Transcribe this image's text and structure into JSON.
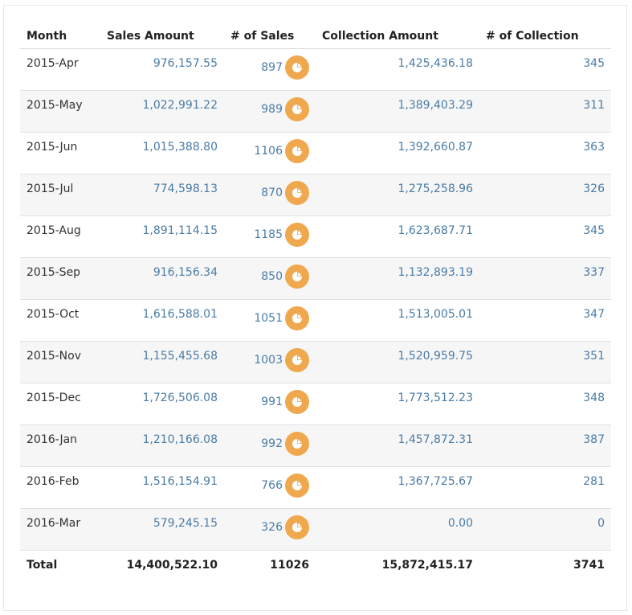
{
  "table": {
    "headers": {
      "month": "Month",
      "sales_amount": "Sales Amount",
      "num_sales": "# of Sales",
      "collection_amount": "Collection Amount",
      "num_collection": "# of Collection"
    },
    "rows": [
      {
        "month": "2015-Apr",
        "sales_amount": "976,157.55",
        "num_sales": "897",
        "collection_amount": "1,425,436.18",
        "num_collection": "345"
      },
      {
        "month": "2015-May",
        "sales_amount": "1,022,991.22",
        "num_sales": "989",
        "collection_amount": "1,389,403.29",
        "num_collection": "311"
      },
      {
        "month": "2015-Jun",
        "sales_amount": "1,015,388.80",
        "num_sales": "1106",
        "collection_amount": "1,392,660.87",
        "num_collection": "363"
      },
      {
        "month": "2015-Jul",
        "sales_amount": "774,598.13",
        "num_sales": "870",
        "collection_amount": "1,275,258.96",
        "num_collection": "326"
      },
      {
        "month": "2015-Aug",
        "sales_amount": "1,891,114.15",
        "num_sales": "1185",
        "collection_amount": "1,623,687.71",
        "num_collection": "345"
      },
      {
        "month": "2015-Sep",
        "sales_amount": "916,156.34",
        "num_sales": "850",
        "collection_amount": "1,132,893.19",
        "num_collection": "337"
      },
      {
        "month": "2015-Oct",
        "sales_amount": "1,616,588.01",
        "num_sales": "1051",
        "collection_amount": "1,513,005.01",
        "num_collection": "347"
      },
      {
        "month": "2015-Nov",
        "sales_amount": "1,155,455.68",
        "num_sales": "1003",
        "collection_amount": "1,520,959.75",
        "num_collection": "351"
      },
      {
        "month": "2015-Dec",
        "sales_amount": "1,726,506.08",
        "num_sales": "991",
        "collection_amount": "1,773,512.23",
        "num_collection": "348"
      },
      {
        "month": "2016-Jan",
        "sales_amount": "1,210,166.08",
        "num_sales": "992",
        "collection_amount": "1,457,872.31",
        "num_collection": "387"
      },
      {
        "month": "2016-Feb",
        "sales_amount": "1,516,154.91",
        "num_sales": "766",
        "collection_amount": "1,367,725.67",
        "num_collection": "281"
      },
      {
        "month": "2016-Mar",
        "sales_amount": "579,245.15",
        "num_sales": "326",
        "collection_amount": "0.00",
        "num_collection": "0"
      }
    ],
    "total": {
      "label": "Total",
      "sales_amount": "14,400,522.10",
      "num_sales": "11026",
      "collection_amount": "15,872,415.17",
      "num_collection": "3741"
    }
  },
  "colors": {
    "link_value": "#4a7ba6",
    "pie_button": "#f0a84e",
    "alt_row": "#f6f6f6"
  },
  "icons": {
    "row_action": "pie-chart-icon"
  }
}
